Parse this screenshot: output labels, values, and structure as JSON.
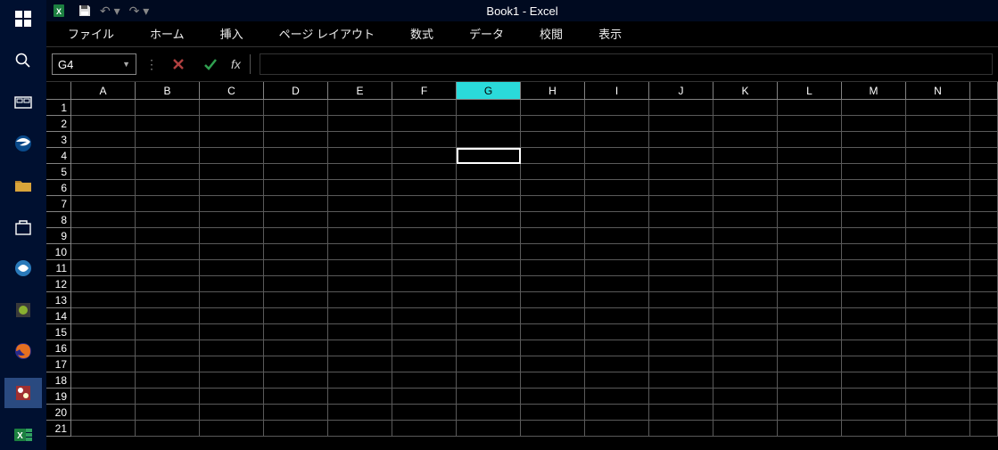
{
  "title": "Book1 - Excel",
  "ribbon": {
    "tabs": [
      "ファイル",
      "ホーム",
      "挿入",
      "ページ レイアウト",
      "数式",
      "データ",
      "校閲",
      "表示"
    ]
  },
  "formula_bar": {
    "name_box": "G4",
    "cancel_icon": "✕",
    "enter_icon": "✓",
    "fx_label": "fx",
    "formula": ""
  },
  "grid": {
    "columns": [
      "A",
      "B",
      "C",
      "D",
      "E",
      "F",
      "G",
      "H",
      "I",
      "J",
      "K",
      "L",
      "M",
      "N"
    ],
    "rows": [
      "1",
      "2",
      "3",
      "4",
      "5",
      "6",
      "7",
      "8",
      "9",
      "10",
      "11",
      "12",
      "13",
      "14",
      "15",
      "16",
      "17",
      "18",
      "19",
      "20",
      "21"
    ],
    "selected_column": "G",
    "active_cell": {
      "row": "4",
      "col": "G"
    }
  },
  "taskbar": {
    "items": [
      {
        "name": "start-icon"
      },
      {
        "name": "search-icon"
      },
      {
        "name": "taskview-icon"
      },
      {
        "name": "edge-icon"
      },
      {
        "name": "fileexplorer-icon"
      },
      {
        "name": "store-icon"
      },
      {
        "name": "app-icon-1"
      },
      {
        "name": "app-icon-2"
      },
      {
        "name": "firefox-icon"
      },
      {
        "name": "app-icon-3"
      },
      {
        "name": "excel-icon"
      }
    ]
  }
}
